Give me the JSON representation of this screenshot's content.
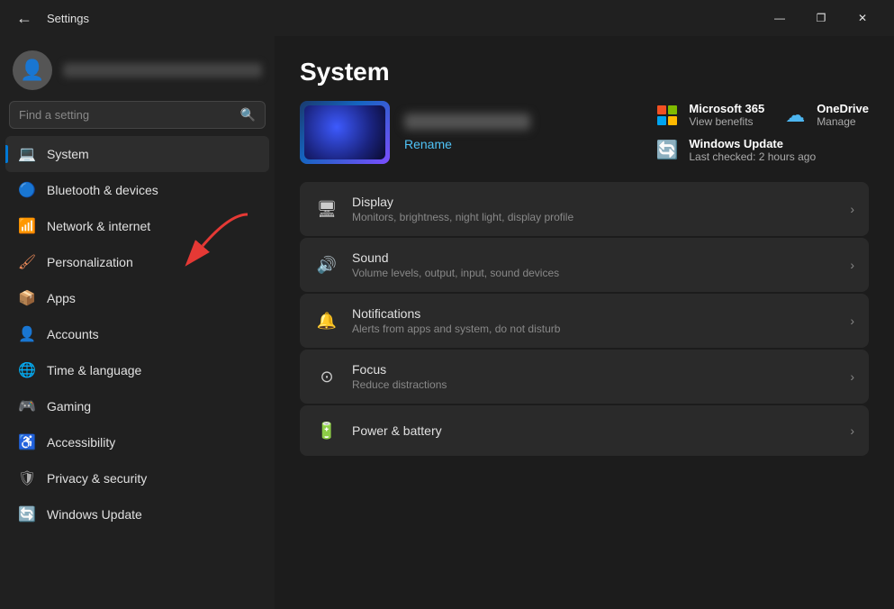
{
  "titlebar": {
    "back_label": "←",
    "title": "Settings",
    "minimize": "—",
    "maximize": "❐",
    "close": "✕"
  },
  "sidebar": {
    "search_placeholder": "Find a setting",
    "nav_items": [
      {
        "id": "system",
        "label": "System",
        "icon": "💻",
        "icon_class": "icon-system",
        "active": true
      },
      {
        "id": "bluetooth",
        "label": "Bluetooth & devices",
        "icon": "🔵",
        "icon_class": "icon-bluetooth",
        "active": false
      },
      {
        "id": "network",
        "label": "Network & internet",
        "icon": "📶",
        "icon_class": "icon-network",
        "active": false
      },
      {
        "id": "personalization",
        "label": "Personalization",
        "icon": "🖌",
        "icon_class": "icon-personalization",
        "active": false
      },
      {
        "id": "apps",
        "label": "Apps",
        "icon": "📦",
        "icon_class": "icon-apps",
        "active": false
      },
      {
        "id": "accounts",
        "label": "Accounts",
        "icon": "👤",
        "icon_class": "icon-accounts",
        "active": false
      },
      {
        "id": "time",
        "label": "Time & language",
        "icon": "🌐",
        "icon_class": "icon-time",
        "active": false
      },
      {
        "id": "gaming",
        "label": "Gaming",
        "icon": "🎮",
        "icon_class": "icon-gaming",
        "active": false
      },
      {
        "id": "accessibility",
        "label": "Accessibility",
        "icon": "♿",
        "icon_class": "icon-accessibility",
        "active": false
      },
      {
        "id": "privacy",
        "label": "Privacy & security",
        "icon": "🛡",
        "icon_class": "icon-privacy",
        "active": false
      },
      {
        "id": "update",
        "label": "Windows Update",
        "icon": "🔄",
        "icon_class": "icon-update",
        "active": false
      }
    ]
  },
  "content": {
    "page_title": "System",
    "device": {
      "rename_label": "Rename"
    },
    "right_cards": [
      {
        "id": "ms365",
        "title": "Microsoft 365",
        "subtitle": "View benefits"
      },
      {
        "id": "onedrive",
        "title": "OneDrive",
        "subtitle": "Manage"
      },
      {
        "id": "windows_update",
        "title": "Windows Update",
        "subtitle": "Last checked: 2 hours ago"
      }
    ],
    "settings": [
      {
        "id": "display",
        "icon": "🖥",
        "title": "Display",
        "subtitle": "Monitors, brightness, night light, display profile"
      },
      {
        "id": "sound",
        "icon": "🔊",
        "title": "Sound",
        "subtitle": "Volume levels, output, input, sound devices"
      },
      {
        "id": "notifications",
        "icon": "🔔",
        "title": "Notifications",
        "subtitle": "Alerts from apps and system, do not disturb"
      },
      {
        "id": "focus",
        "icon": "⊙",
        "title": "Focus",
        "subtitle": "Reduce distractions"
      },
      {
        "id": "power",
        "icon": "🔋",
        "title": "Power & battery",
        "subtitle": ""
      }
    ]
  }
}
